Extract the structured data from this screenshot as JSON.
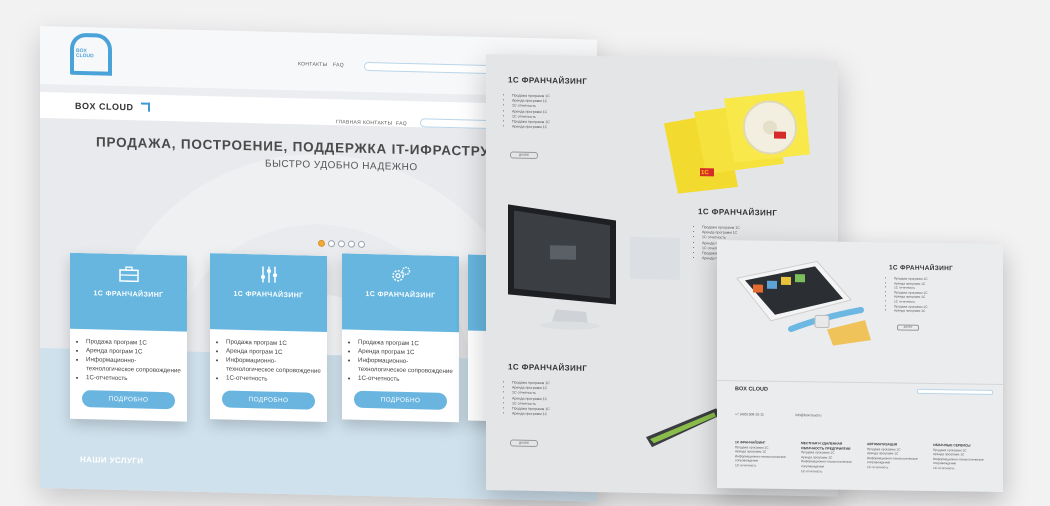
{
  "panel1": {
    "logo_text": "BOX\nCLOUD",
    "top_menu": [
      "КОНТАКТЫ",
      "FAQ"
    ],
    "brand": "BOX CLOUD",
    "nav": [
      "ГЛАВНАЯ",
      "КОНТАКТЫ",
      "FAQ"
    ],
    "hero_title": "ПРОДАЖА, ПОСТРОЕНИЕ, ПОДДЕРЖКА IT-ИФРАСТРУКТУРЫ ПРЕДПРИЯТИЯ",
    "hero_subtitle": "БЫСТРО УДОБНО НАДЕЖНО",
    "slider_active_index": 0,
    "slider_count": 5,
    "cards": [
      {
        "icon": "briefcase-icon",
        "title": "1С ФРАНЧАЙЗИНГ",
        "items": [
          "Продажа програм 1С",
          "Аренда програм 1С",
          "Информационно-технологическое сопровождение",
          "1С-отчетность"
        ],
        "button": "ПОДРОБНО"
      },
      {
        "icon": "sliders-icon",
        "title": "1С ФРАНЧАЙЗИНГ",
        "items": [
          "Продажа програм 1С",
          "Аренда програм 1С",
          "Информационно-технологическое сопровождение",
          "1С-отчетность"
        ],
        "button": "ПОДРОБНО"
      },
      {
        "icon": "gears-icon",
        "title": "1С ФРАНЧАЙЗИНГ",
        "items": [
          "Продажа програм 1С",
          "Аренда програм 1С",
          "Информационно-технологическое сопровождение",
          "1С-отчетность"
        ],
        "button": "ПОДРОБНО"
      }
    ],
    "services_heading": "НАШИ УСЛУГИ"
  },
  "panel2": {
    "sections": [
      {
        "title": "1С ФРАНЧАЙЗИНГ",
        "items": [
          "Продажа программ 1С",
          "Аренда программ 1С",
          "1С отчетность",
          "Аренда программ 1С",
          "1С отчетность",
          "Продажа программ 1С",
          "Аренда программ 1С"
        ],
        "button": "ДАЛЕЕ"
      },
      {
        "title": "1С ФРАНЧАЙЗИНГ",
        "items": [
          "Продажа программ 1С",
          "Аренда программ 1С",
          "1С отчетность",
          "Аренда программ 1С",
          "1С отчетность",
          "Продажа программ 1С",
          "Аренда программ 1С"
        ],
        "button": "ДАЛЕЕ"
      },
      {
        "title": "1С ФРАНЧАЙЗИНГ",
        "items": [
          "Продажа программ 1С",
          "Аренда программ 1С",
          "1С отчетность",
          "Аренда программ 1С",
          "1С отчетность",
          "Продажа программ 1С",
          "Аренда программ 1С"
        ],
        "button": "ДАЛЕЕ"
      }
    ],
    "box_label": "1С"
  },
  "panel3": {
    "section": {
      "title": "1С ФРАНЧАЙЗИНГ",
      "items": [
        "Продажа программ 1С",
        "Аренда программ 1С",
        "1С отчетность",
        "Продажа программ 1С",
        "Аренда программ 1С",
        "1С отчетность",
        "Продажа программ 1С",
        "Аренда программ 1С"
      ],
      "button": "ДАЛЕЕ"
    },
    "brand": "BOX CLOUD",
    "phone": "+7 (495) 908-32-11",
    "email": "info@boxcloud.ru",
    "footer_cols": [
      {
        "title": "1С ФРАНЧАЙЗИНГ",
        "items": [
          "Продажа программ 1С",
          "Аренда программ 1С",
          "Информационно-технологическое сопровождение",
          "1С-отчетность"
        ]
      },
      {
        "title": "МЕСТНАЯ И УДАЛЕННАЯ ОБЛАЧНОСТЬ ПРЕДПРИЯТИЯ",
        "items": [
          "Продажа программ 1С",
          "Аренда программ 1С",
          "Информационно-технологическое сопровождение",
          "1С-отчетность"
        ]
      },
      {
        "title": "АВТОМАТИЗАЦИЯ",
        "items": [
          "Продажа программ 1С",
          "Аренда программ 1С",
          "Информационно-технологическое сопровождение",
          "1С-отчетность"
        ]
      },
      {
        "title": "ОБЛАЧНЫЕ СЕРВИСЫ",
        "items": [
          "Продажа программ 1С",
          "Аренда программ 1С",
          "Информационно-технологическое сопровождение",
          "1С-отчетность"
        ]
      }
    ]
  },
  "colors": {
    "accent": "#67b6e0",
    "button": "#6ab5e0",
    "bg": "#f2f2f3",
    "slider_active": "#f1a93a"
  }
}
